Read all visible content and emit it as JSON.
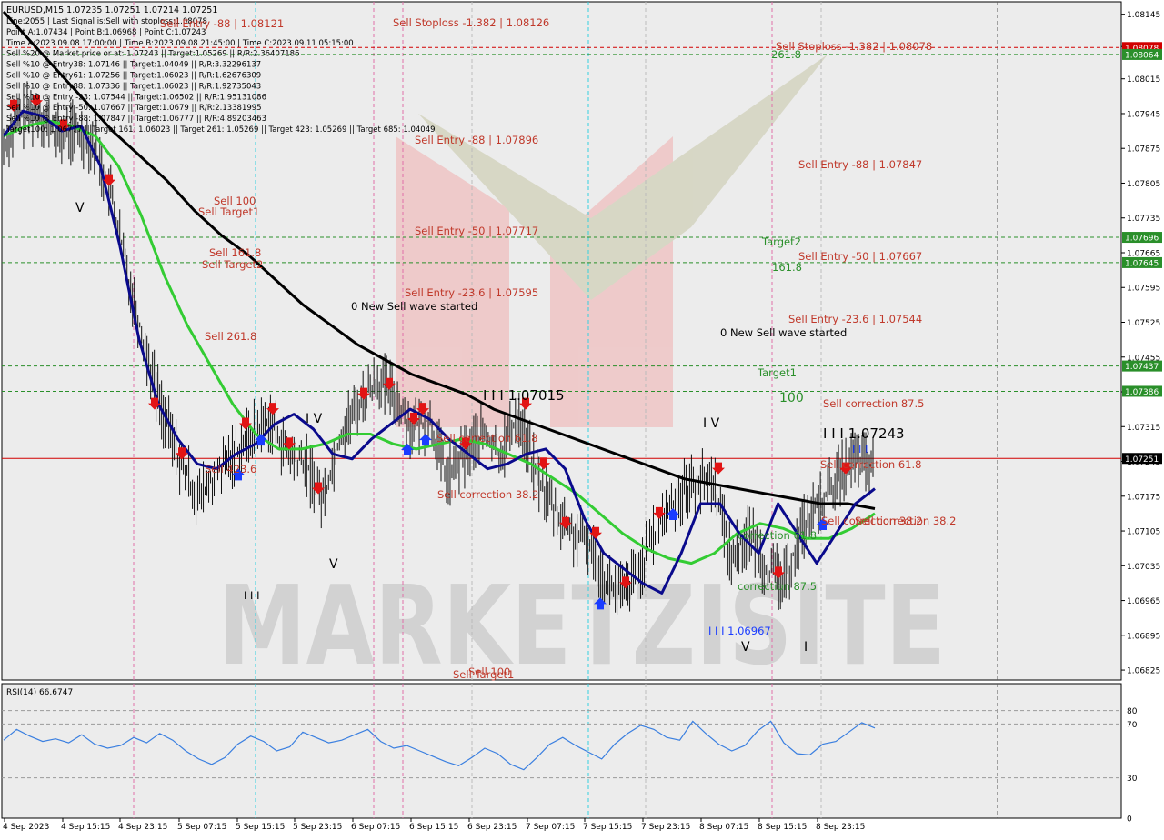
{
  "header": {
    "symbol_line": "EURUSD,M15  1.07235 1.07251 1.07214 1.07251",
    "info_lines": [
      "Line:2055 | Last Signal is:Sell with stoploss:1.08078",
      "Point A:1.07434 | Point B:1.06968 | Point C:1.07243",
      "Time A:2023.09.08 17:00:00 | Time B:2023.09.08 21:45:00 | Time C:2023.09.11 05:15:00",
      "Sell %20 @ Market price or at: 1.07243 || Target:1.05269 || R/R:2.36407186",
      "Sell %10 @ Entry38: 1.07146 || Target:1.04049 || R/R:3.32296137",
      "Sell %10 @ Entry61: 1.07256 || Target:1.06023 || R/R:1.62676309",
      "Sell %10 @ Entry88: 1.07336 || Target:1.06023 || R/R:1.92735043",
      "Sell %10 @ Entry -23: 1.07544 || Target:1.06502 || R/R:1.95131086",
      "Sell %10 @ Entry -50: 1.07667 || Target:1.0679 || R/R:2.13381995",
      "Sell %10 @ Entry -88: 1.07847 || Target:1.06777 || R/R:4.89203463",
      "Target100: 1.06777 || Target 161: 1.06023 || Target 261: 1.05269 || Target 423: 1.05269 || Target 685: 1.04049"
    ]
  },
  "watermark": "MARKETZISITE",
  "rsi_label": "RSI(14) 66.6747",
  "colors": {
    "ma_black": "#000000",
    "ma_blue": "#0a0a8c",
    "ma_green": "#33cc33",
    "rsi": "#3a7fe0",
    "sell_red": "#e21414",
    "buy_blue": "#1a3cff",
    "level_green": "#2a8f2a",
    "text_red": "#c0392b",
    "price_tag_red": "#d10000",
    "grid": "#c8c8c8"
  },
  "chart_data": [
    {
      "type": "line",
      "title": "EURUSD,M15",
      "price_axis": [
        "1.08145",
        "1.08080",
        "1.08015",
        "1.07945",
        "1.07875",
        "1.07805",
        "1.07735",
        "1.07665",
        "1.07595",
        "1.07525",
        "1.07455",
        "1.07385",
        "1.07315",
        "1.07245",
        "1.07175",
        "1.07105",
        "1.07035",
        "1.06965",
        "1.06895",
        "1.06825"
      ],
      "price_tags": [
        {
          "value": "1.08078",
          "color": "#d10000"
        },
        {
          "value": "1.08064",
          "color": "#2a8f2a"
        },
        {
          "value": "1.07696",
          "color": "#2a8f2a"
        },
        {
          "value": "1.07645",
          "color": "#2a8f2a"
        },
        {
          "value": "1.07437",
          "color": "#2a8f2a"
        },
        {
          "value": "1.07386",
          "color": "#2a8f2a"
        },
        {
          "value": "1.07251",
          "color": "#000000"
        }
      ],
      "time_axis": [
        "4 Sep 2023",
        "4 Sep 15:15",
        "4 Sep 23:15",
        "5 Sep 07:15",
        "5 Sep 15:15",
        "5 Sep 23:15",
        "6 Sep 07:15",
        "6 Sep 15:15",
        "6 Sep 23:15",
        "7 Sep 07:15",
        "7 Sep 15:15",
        "7 Sep 23:15",
        "8 Sep 07:15",
        "8 Sep 15:15",
        "8 Sep 23:15"
      ],
      "ylim": [
        1.06805,
        1.0817
      ],
      "close_series": [
        1.0788,
        1.0794,
        1.0795,
        1.079,
        1.0791,
        1.0789,
        1.0779,
        1.0762,
        1.0747,
        1.0734,
        1.0724,
        1.0717,
        1.0722,
        1.0726,
        1.073,
        1.0733,
        1.0726,
        1.0724,
        1.0717,
        1.073,
        1.0736,
        1.0741,
        1.0738,
        1.0731,
        1.0733,
        1.0721,
        1.0726,
        1.073,
        1.0726,
        1.0734,
        1.0722,
        1.0715,
        1.071,
        1.0708,
        1.07,
        1.0698,
        1.0704,
        1.0712,
        1.0718,
        1.072,
        1.0721,
        1.0705,
        1.071,
        1.0703,
        1.07,
        1.0711,
        1.0716,
        1.0721,
        1.0725,
        1.0723
      ],
      "ma_black": [
        1.0815,
        1.0809,
        1.0803,
        1.0797,
        1.0791,
        1.0786,
        1.0781,
        1.0775,
        1.077,
        1.0766,
        1.0761,
        1.0756,
        1.0752,
        1.0748,
        1.0745,
        1.0742,
        1.074,
        1.0738,
        1.0735,
        1.0733,
        1.0731,
        1.0729,
        1.0727,
        1.0725,
        1.0723,
        1.0721,
        1.072,
        1.0719,
        1.0718,
        1.0717,
        1.0716,
        1.0716,
        1.0715
      ],
      "ma_blue": [
        1.079,
        1.0795,
        1.0794,
        1.0791,
        1.0792,
        1.0784,
        1.0768,
        1.0749,
        1.0736,
        1.0729,
        1.0724,
        1.0723,
        1.0726,
        1.0728,
        1.0732,
        1.0734,
        1.0731,
        1.0726,
        1.0725,
        1.0729,
        1.0732,
        1.0735,
        1.0733,
        1.0729,
        1.0726,
        1.0723,
        1.0724,
        1.0726,
        1.0727,
        1.0723,
        1.0713,
        1.0706,
        1.0703,
        1.07,
        1.0698,
        1.0706,
        1.0716,
        1.0716,
        1.071,
        1.0706,
        1.0716,
        1.071,
        1.0704,
        1.071,
        1.0716,
        1.0719
      ],
      "ma_green": [
        1.079,
        1.0792,
        1.0793,
        1.0792,
        1.079,
        1.0784,
        1.0774,
        1.0762,
        1.0752,
        1.0744,
        1.0736,
        1.073,
        1.0727,
        1.0727,
        1.0728,
        1.073,
        1.073,
        1.0728,
        1.0727,
        1.0728,
        1.0729,
        1.0728,
        1.0726,
        1.0724,
        1.0721,
        1.0718,
        1.0714,
        1.071,
        1.0707,
        1.0705,
        1.0704,
        1.0706,
        1.071,
        1.0712,
        1.0711,
        1.0709,
        1.0709,
        1.0711,
        1.0714
      ],
      "annotations": [
        {
          "text": "Sell Stoploss -1.382 | 1.08126",
          "color": "#c0392b"
        },
        {
          "text": "Sell Stoploss -1.382 | 1.08078",
          "color": "#c0392b"
        },
        {
          "text": "Sell Entry -88 | 1.08121",
          "color": "#c0392b"
        },
        {
          "text": "Sell Entry -88 | 1.07896",
          "color": "#c0392b"
        },
        {
          "text": "Sell Entry -88 | 1.07847",
          "color": "#c0392b"
        },
        {
          "text": "Sell Entry -50 | 1.07717",
          "color": "#c0392b"
        },
        {
          "text": "Sell Entry -50 | 1.07667",
          "color": "#c0392b"
        },
        {
          "text": "Sell Entry -23.6 | 1.07595",
          "color": "#c0392b"
        },
        {
          "text": "Sell Entry -23.6 | 1.07544",
          "color": "#c0392b"
        },
        {
          "text": "0 New Sell wave started",
          "color": "#000000"
        },
        {
          "text": "0 New Sell wave started",
          "color": "#000000"
        },
        {
          "text": "261.8",
          "color": "#2a8f2a"
        },
        {
          "text": "Target2",
          "color": "#2a8f2a"
        },
        {
          "text": "161.8",
          "color": "#2a8f2a"
        },
        {
          "text": "Target1",
          "color": "#2a8f2a"
        },
        {
          "text": "100",
          "color": "#2a8f2a"
        },
        {
          "text": "Sell correction 87.5",
          "color": "#c0392b"
        },
        {
          "text": "I I I 1.07243",
          "color": "#000000"
        },
        {
          "text": "Sell correction 61.8",
          "color": "#c0392b"
        },
        {
          "text": "Sell correction 38.2",
          "color": "#c0392b"
        },
        {
          "text": "correction 61.8",
          "color": "#2a8f2a"
        },
        {
          "text": "correction 87.5",
          "color": "#2a8f2a"
        },
        {
          "text": "I I I 1.06967",
          "color": "#1a3cff"
        },
        {
          "text": "I I I 1.07015",
          "color": "#000000"
        },
        {
          "text": "Sell correction 61.8",
          "color": "#c0392b"
        },
        {
          "text": "Sell correction 38.2",
          "color": "#c0392b"
        },
        {
          "text": "Sell correction 38.2",
          "color": "#c0392b"
        },
        {
          "text": "Sell 100",
          "color": "#c0392b"
        },
        {
          "text": "Sell Target1",
          "color": "#c0392b"
        },
        {
          "text": "Sell 161.8",
          "color": "#c0392b"
        },
        {
          "text": "Sell Target2",
          "color": "#c0392b"
        },
        {
          "text": "Sell 261.8",
          "color": "#c0392b"
        },
        {
          "text": "Sell 423.6",
          "color": "#c0392b"
        },
        {
          "text": "Sell 100",
          "color": "#c0392b"
        },
        {
          "text": "Sell Target1",
          "color": "#c0392b"
        },
        {
          "text": "I V",
          "color": "#000000"
        },
        {
          "text": "I V",
          "color": "#000000"
        },
        {
          "text": "V",
          "color": "#000000"
        },
        {
          "text": "V",
          "color": "#000000"
        },
        {
          "text": "V",
          "color": "#000000"
        },
        {
          "text": "I I I",
          "color": "#000000"
        },
        {
          "text": "I I I",
          "color": "#1a3cff"
        },
        {
          "text": "I",
          "color": "#000000"
        }
      ]
    },
    {
      "type": "line",
      "title": "RSI(14) 66.6747",
      "ylim": [
        0,
        100
      ],
      "levels": [
        "80",
        "70",
        "30",
        "0"
      ],
      "values": [
        58,
        66,
        61,
        57,
        59,
        56,
        62,
        55,
        52,
        54,
        60,
        56,
        63,
        58,
        50,
        44,
        40,
        45,
        55,
        61,
        57,
        50,
        53,
        64,
        60,
        56,
        58,
        62,
        66,
        57,
        52,
        54,
        50,
        46,
        42,
        39,
        45,
        52,
        48,
        40,
        36,
        45,
        55,
        60,
        54,
        49,
        44,
        55,
        63,
        69,
        66,
        60,
        58,
        72,
        63,
        55,
        50,
        54,
        65,
        72,
        56,
        48,
        47,
        55,
        57,
        64,
        71,
        67
      ]
    }
  ]
}
